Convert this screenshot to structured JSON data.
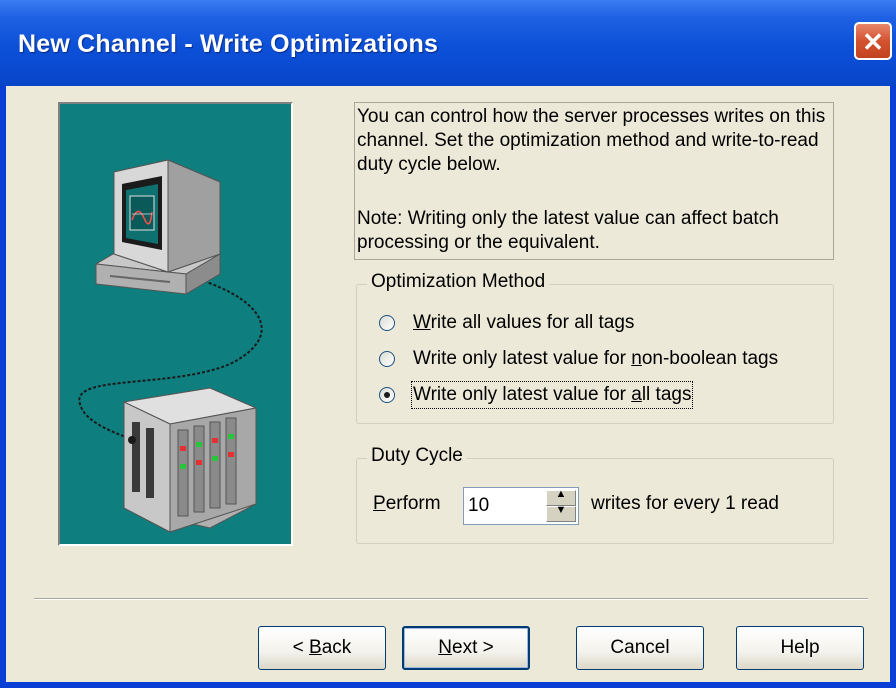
{
  "window": {
    "title": "New Channel - Write Optimizations",
    "close_symbol": "✕"
  },
  "info": {
    "paragraph1": "You can control how the server processes writes on this channel.  Set the optimization method and write-to-read duty cycle below.",
    "paragraph2": "Note:  Writing only the latest value can affect batch processing or the equivalent."
  },
  "optimization": {
    "title": "Optimization Method",
    "options": [
      {
        "label_pre": "",
        "label_u": "W",
        "label_post": "rite all values for all tags",
        "selected": false
      },
      {
        "label_pre": "Write only latest value for ",
        "label_u": "n",
        "label_post": "on-boolean tags",
        "selected": false
      },
      {
        "label_pre": "Write only latest value for ",
        "label_u": "a",
        "label_post": "ll tags",
        "selected": true
      }
    ]
  },
  "duty_cycle": {
    "title": "Duty Cycle",
    "perform_u": "P",
    "perform_rest": "erform",
    "value": "10",
    "suffix": "writes for every 1 read"
  },
  "buttons": {
    "back_pre": "< ",
    "back_u": "B",
    "back_post": "ack",
    "next_u": "N",
    "next_post": "ext >",
    "cancel": "Cancel",
    "help": "Help"
  },
  "illustration": {
    "background": "#0e7e7e",
    "icons": [
      "computer-monitor-icon",
      "plc-device-icon",
      "cable-icon"
    ]
  }
}
